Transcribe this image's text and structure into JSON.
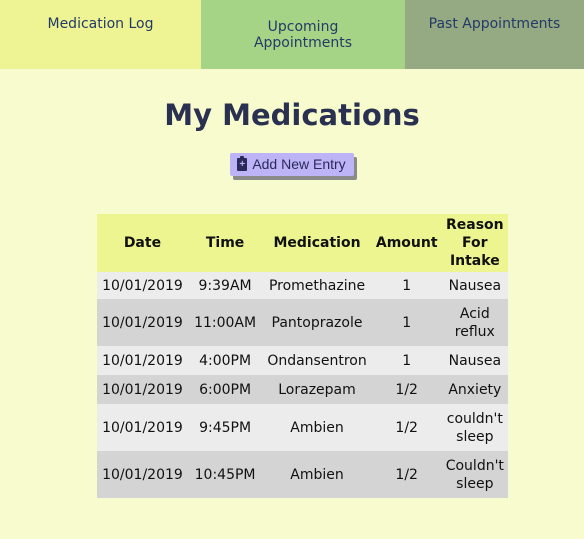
{
  "nav": {
    "tabs": [
      {
        "label": "Medication Log"
      },
      {
        "label_line1": "Upcoming",
        "label_line2": "Appointments"
      },
      {
        "label": "Past Appointments"
      }
    ]
  },
  "page": {
    "title": "My Medications",
    "add_button_label": "Add New Entry"
  },
  "table": {
    "headers": [
      "Date",
      "Time",
      "Medication",
      "Amount",
      "Reason For Intake"
    ],
    "rows": [
      {
        "date": "10/01/2019",
        "time": "9:39AM",
        "medication": "Promethazine",
        "amount": "1",
        "reason": "Nausea"
      },
      {
        "date": "10/01/2019",
        "time": "11:00AM",
        "medication": "Pantoprazole",
        "amount": "1",
        "reason": "Acid reflux"
      },
      {
        "date": "10/01/2019",
        "time": "4:00PM",
        "medication": "Ondansentron",
        "amount": "1",
        "reason": "Nausea"
      },
      {
        "date": "10/01/2019",
        "time": "6:00PM",
        "medication": "Lorazepam",
        "amount": "1/2",
        "reason": "Anxiety"
      },
      {
        "date": "10/01/2019",
        "time": "9:45PM",
        "medication": "Ambien",
        "amount": "1/2",
        "reason": "couldn't sleep"
      },
      {
        "date": "10/01/2019",
        "time": "10:45PM",
        "medication": "Ambien",
        "amount": "1/2",
        "reason": "Couldn't sleep"
      }
    ]
  },
  "colors": {
    "page_bg": "#f7fbce",
    "tab_medication_log": "#eef493",
    "tab_upcoming": "#a6d487",
    "tab_past": "#95a982",
    "button_bg": "#bdb3f7",
    "header_bg": "#ecf58f"
  },
  "icons": {
    "add_button": "clipboard-plus-icon"
  }
}
